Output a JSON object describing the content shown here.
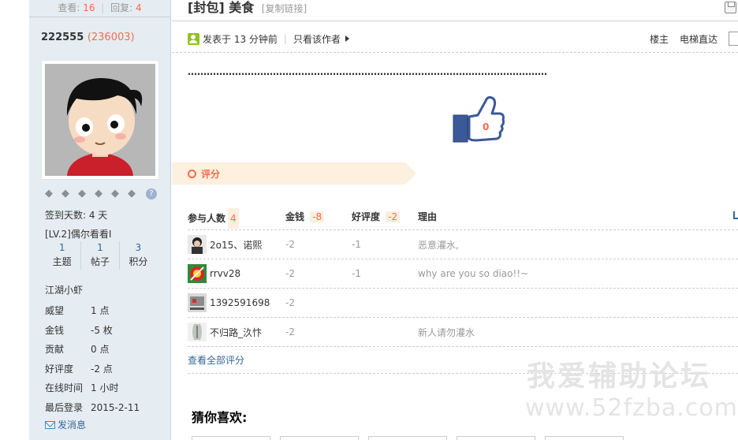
{
  "sidebar": {
    "views_label": "查看:",
    "views": "16",
    "replies_label": "回复:",
    "replies": "4",
    "username": "222555",
    "uid": "236003",
    "help_icon": "?",
    "signin_days": "签到天数: 4 天",
    "level": "[LV.2]偶尔看看I",
    "counts": [
      {
        "value": "1",
        "label": "主题"
      },
      {
        "value": "1",
        "label": "帖子"
      },
      {
        "value": "3",
        "label": "积分"
      }
    ],
    "group_title": "江湖小虾",
    "profile": [
      {
        "key": "威望",
        "value": "1 点"
      },
      {
        "key": "金钱",
        "value": "-5 枚"
      },
      {
        "key": "贡献",
        "value": "0 点"
      },
      {
        "key": "好评度",
        "value": "-2 点"
      },
      {
        "key": "在线时间",
        "value": "1 小时"
      },
      {
        "key": "最后登录",
        "value": "2015-2-11"
      }
    ],
    "pm_label": "发消息"
  },
  "post": {
    "title": "[封包] 美食",
    "copy_link": "[复制链接]",
    "posted": "发表于 13 分钟前",
    "only_author": "只看该作者",
    "floor_label": "楼主",
    "jump_label": "电梯直达",
    "content": "……………………………………………………………………………………………………",
    "like_count": "0"
  },
  "rating": {
    "header": "评分",
    "columns": {
      "participants": "参与人数",
      "participants_count": "4",
      "money": "金钱",
      "money_total": "-8",
      "reputation": "好评度",
      "reputation_total": "-2",
      "reason": "理由"
    },
    "rows": [
      {
        "user": "2o15、诺熙",
        "money": "-2",
        "reputation": "-1",
        "reason": "恶意灌水,"
      },
      {
        "user": "rrvv28",
        "money": "-2",
        "reputation": "-1",
        "reason": "why are you so diao!!~"
      },
      {
        "user": "1392591698",
        "money": "-2",
        "reputation": "",
        "reason": ""
      },
      {
        "user": "不归路_汣忭",
        "money": "-2",
        "reputation": "",
        "reason": "新人请勿灌水"
      }
    ],
    "view_all": "查看全部评分"
  },
  "guess_title": "猜你喜欢:",
  "watermark": {
    "line1": "我爱辅助论坛",
    "line2": "www.52fzba.com"
  },
  "colors": {
    "accent": "#f26c4f",
    "link": "#336699",
    "sidebar_bg": "#e5edf2",
    "rate_bg": "#fdf0de"
  }
}
